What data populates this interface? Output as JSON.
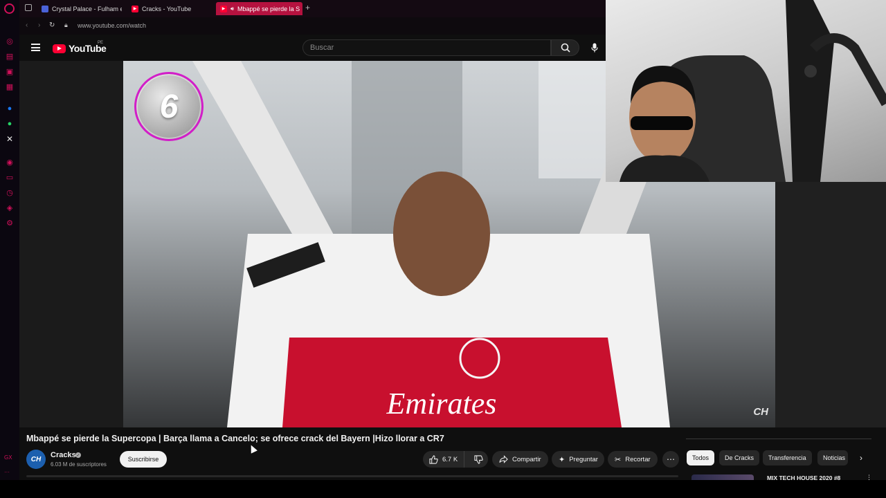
{
  "browser": {
    "tabs": [
      {
        "title": "Crystal Palace - Fulham en",
        "icon": "crystal-palace-favicon"
      },
      {
        "title": "Cracks - YouTube",
        "icon": "youtube-favicon"
      },
      {
        "title": "Mbappé se pierde la S",
        "icon": "youtube-favicon",
        "active": true
      }
    ],
    "new_tab_label": "+",
    "url": "www.youtube.com/watch"
  },
  "youtube": {
    "logo_text": "YouTube",
    "region": "PE",
    "search_placeholder": "Buscar"
  },
  "video": {
    "number_badge": "6",
    "watermark": "CH",
    "title": "Mbappé se pierde la Supercopa | Barça llama a Cancelo; se ofrece crack del Bayern |Hizo llorar a CR7"
  },
  "channel": {
    "avatar_text": "CH",
    "name": "Cracks",
    "subscribers": "6.03 M de suscriptores",
    "subscribe_label": "Suscribirse"
  },
  "actions": {
    "likes": "6.7 K",
    "share_label": "Compartir",
    "ask_label": "Preguntar",
    "clip_label": "Recortar",
    "more_label": "⋯"
  },
  "chips": [
    "Todos",
    "De Cracks",
    "Transferencia",
    "Noticias"
  ],
  "related": {
    "first_title": "MIX TECH HOUSE 2020 #8"
  },
  "colors": {
    "yt_red": "#ff0033",
    "gx_accent": "#d1105a",
    "badge_ring": "#d21ec8"
  }
}
